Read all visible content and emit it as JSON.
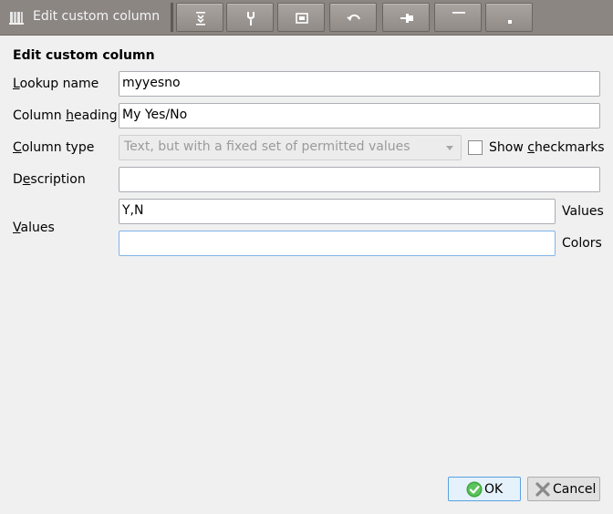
{
  "window": {
    "title": "Edit custom column",
    "toolbar_buttons": [
      {
        "name": "collapse-icon"
      },
      {
        "name": "pin-icon"
      },
      {
        "name": "window-icon"
      },
      {
        "name": "undo-icon"
      },
      {
        "name": "push-pin-icon"
      },
      {
        "name": "minimize-icon"
      },
      {
        "name": "restore-icon"
      }
    ]
  },
  "form": {
    "heading": "Edit custom column",
    "lookup_name": {
      "label_pre": "",
      "label_acc": "L",
      "label_post": "ookup name",
      "value": "myyesno"
    },
    "column_heading": {
      "label_pre": "Column ",
      "label_acc": "h",
      "label_post": "eading",
      "value": "My Yes/No"
    },
    "column_type": {
      "label_pre": "",
      "label_acc": "C",
      "label_post": "olumn type",
      "value": "Text, but with a fixed set of permitted values"
    },
    "show_checkmarks": {
      "label_pre": "Show ",
      "label_acc": "c",
      "label_post": "heckmarks",
      "checked": false
    },
    "description": {
      "label_pre": "D",
      "label_acc": "e",
      "label_post": "scription",
      "value": ""
    },
    "values": {
      "label_pre": "",
      "label_acc": "V",
      "label_post": "alues",
      "values_value": "Y,N",
      "values_side_label": "Values",
      "colors_value": "",
      "colors_side_label": "Colors"
    }
  },
  "buttons": {
    "ok_label": "OK",
    "cancel_label": "Cancel"
  },
  "colors": {
    "titlebar": "#8c8683",
    "ok_check": "#3aa83a",
    "cancel_x": "#8a8a8a",
    "focus_border": "#7eb4ea"
  }
}
